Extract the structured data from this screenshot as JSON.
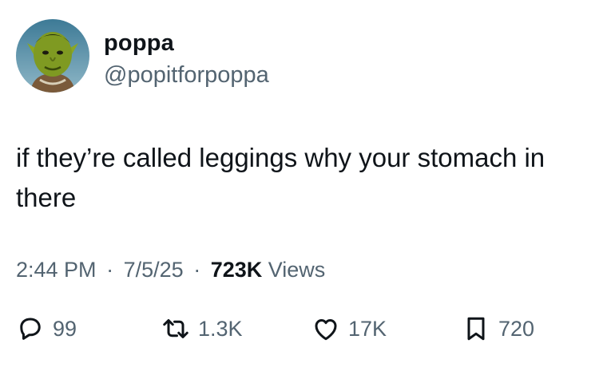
{
  "author": {
    "display_name": "poppa",
    "handle": "@popitforpoppa",
    "avatar_icon": "profile-avatar"
  },
  "tweet": {
    "text": "if they’re called leggings why your stomach in there"
  },
  "meta": {
    "time": "2:44 PM",
    "separator": "·",
    "date": "7/5/25",
    "views_count": "723K",
    "views_label": "Views"
  },
  "actions": {
    "replies": "99",
    "reposts": "1.3K",
    "likes": "17K",
    "bookmarks": "720"
  },
  "colors": {
    "text": "#0f1419",
    "secondary": "#536471",
    "background": "#ffffff"
  }
}
